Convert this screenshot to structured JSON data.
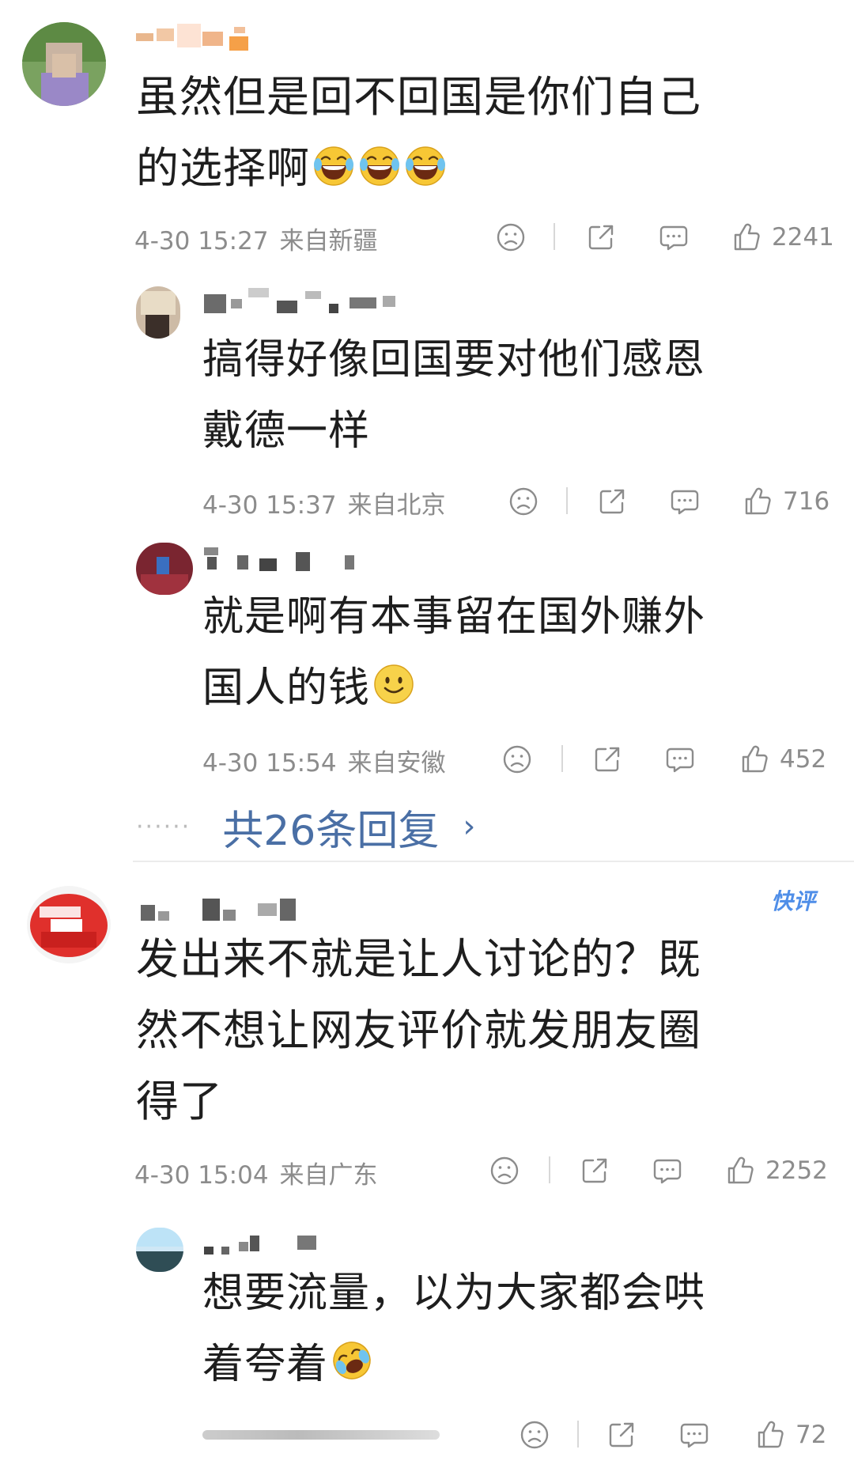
{
  "comments": [
    {
      "text": "虽然但是回不回国是你们自己的选择啊",
      "line1": "虽然但是回不回国是你们自己",
      "line2": "的选择啊",
      "time": "4-30 15:27",
      "location": "来自新疆",
      "likes": "2241",
      "replies": [
        {
          "line1": "搞得好像回国要对他们感恩",
          "line2": "戴德一样",
          "time": "4-30 15:37",
          "location": "来自北京",
          "likes": "716"
        },
        {
          "line1": "就是啊有本事留在国外赚外",
          "line2": "国人的钱",
          "time": "4-30 15:54",
          "location": "来自安徽",
          "likes": "452"
        }
      ],
      "more_replies": "共26条回复"
    },
    {
      "badge": "快评",
      "line1": "发出来不就是让人讨论的？既",
      "line2": "然不想让网友评价就发朋友圈",
      "line3": "得了",
      "time": "4-30 15:04",
      "location": "来自广东",
      "likes": "2252",
      "replies": [
        {
          "line1": "想要流量，以为大家都会哄",
          "line2": "着夸着",
          "likes": "72"
        }
      ]
    }
  ],
  "icons": {
    "dislike": "frown-face-icon",
    "repost": "share-box-icon",
    "comment": "comment-bubble-icon",
    "like": "thumbs-up-icon",
    "laugh_emoji": "tears-of-joy-emoji",
    "smile_emoji": "smile-emoji",
    "cry_laugh_emoji": "rolling-laugh-emoji"
  },
  "colors": {
    "link": "#4a6fa5",
    "meta": "#8c8c8c",
    "badge": "#4f8ee8"
  }
}
